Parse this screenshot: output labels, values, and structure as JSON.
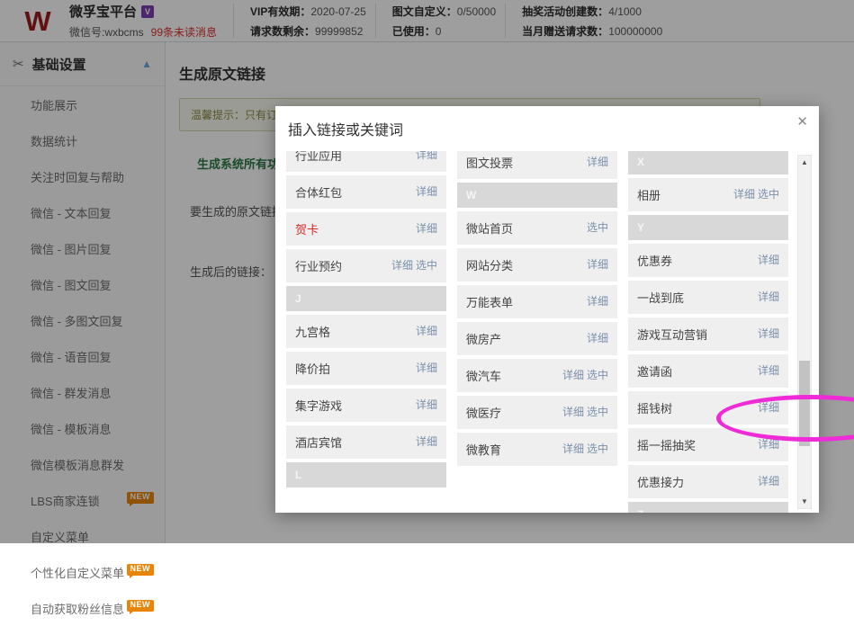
{
  "header": {
    "logo_text": "W",
    "account_name": "微孚宝平台",
    "vip_badge": "V",
    "wechat_id": "微信号:wxbcms",
    "unread": "99条未读消息",
    "stats": [
      {
        "line1_label": "VIP有效期：",
        "line1_value": "2020-07-25",
        "line2_label": "请求数剩余：",
        "line2_value": "99999852"
      },
      {
        "line1_label": "图文自定义：",
        "line1_value": "0/50000",
        "line2_label": "已使用：",
        "line2_value": "0"
      },
      {
        "line1_label": "抽奖活动创建数：",
        "line1_value": "4/1000",
        "line2_label": "当月赠送请求数：",
        "line2_value": "100000000"
      }
    ]
  },
  "sidebar": {
    "section_title": "基础设置",
    "section_icon": "tools-icon",
    "collapse_icon": "chevron-up-icon",
    "items": [
      {
        "label": "功能展示",
        "badge": ""
      },
      {
        "label": "数据统计",
        "badge": ""
      },
      {
        "label": "关注时回复与帮助",
        "badge": ""
      },
      {
        "label": "微信 - 文本回复",
        "badge": ""
      },
      {
        "label": "微信 - 图片回复",
        "badge": ""
      },
      {
        "label": "微信 - 图文回复",
        "badge": ""
      },
      {
        "label": "微信 - 多图文回复",
        "badge": ""
      },
      {
        "label": "微信 - 语音回复",
        "badge": ""
      },
      {
        "label": "微信 - 群发消息",
        "badge": ""
      },
      {
        "label": "微信 - 模板消息",
        "badge": ""
      },
      {
        "label": "微信模板消息群发",
        "badge": ""
      },
      {
        "label": "LBS商家连锁",
        "badge": "NEW"
      },
      {
        "label": "自定义菜单",
        "badge": ""
      },
      {
        "label": "个性化自定义菜单",
        "badge": "NEW"
      },
      {
        "label": "自动获取粉丝信息",
        "badge": "NEW"
      }
    ]
  },
  "page": {
    "title": "生成原文链接",
    "alert": "温馨提示：只有订阅号和服务号才可以使用该功能",
    "green_link": "生成系统所有功能的原文链接",
    "field1_label": "要生成的原文链接：",
    "field2_label": "生成后的链接："
  },
  "modal": {
    "title": "插入链接或关键词",
    "close_icon": "close-icon",
    "action_detail": "详细",
    "action_select": "选中",
    "scrollbar": {
      "up_icon": "caret-up-icon",
      "down_icon": "caret-down-icon"
    },
    "columns": [
      {
        "name": "column-1",
        "offset": -14,
        "entries": [
          {
            "type": "item",
            "label": "行业应用",
            "actions": [
              "详细"
            ],
            "red": false
          },
          {
            "type": "item",
            "label": "合体红包",
            "actions": [
              "详细"
            ],
            "red": false
          },
          {
            "type": "item",
            "label": "贺卡",
            "actions": [
              "详细"
            ],
            "red": true
          },
          {
            "type": "item",
            "label": "行业预约",
            "actions": [
              "详细",
              "选中"
            ],
            "red": false
          },
          {
            "type": "letter",
            "label": "J"
          },
          {
            "type": "item",
            "label": "九宫格",
            "actions": [
              "详细"
            ],
            "red": false
          },
          {
            "type": "item",
            "label": "降价拍",
            "actions": [
              "详细"
            ],
            "red": false
          },
          {
            "type": "item",
            "label": "集字游戏",
            "actions": [
              "详细"
            ],
            "red": false
          },
          {
            "type": "item",
            "label": "酒店宾馆",
            "actions": [
              "详细"
            ],
            "red": false
          },
          {
            "type": "letter",
            "label": "L"
          }
        ]
      },
      {
        "name": "column-2",
        "offset": -6,
        "entries": [
          {
            "type": "item",
            "label": "图文投票",
            "actions": [
              "详细"
            ],
            "red": false
          },
          {
            "type": "letter",
            "label": "W"
          },
          {
            "type": "item",
            "label": "微站首页",
            "actions": [
              "选中"
            ],
            "red": false
          },
          {
            "type": "item",
            "label": "网站分类",
            "actions": [
              "详细"
            ],
            "red": false
          },
          {
            "type": "item",
            "label": "万能表单",
            "actions": [
              "详细"
            ],
            "red": false
          },
          {
            "type": "item",
            "label": "微房产",
            "actions": [
              "详细"
            ],
            "red": false
          },
          {
            "type": "item",
            "label": "微汽车",
            "actions": [
              "详细",
              "选中"
            ],
            "red": false
          },
          {
            "type": "item",
            "label": "微医疗",
            "actions": [
              "详细",
              "选中"
            ],
            "red": false
          },
          {
            "type": "item",
            "label": "微教育",
            "actions": [
              "详细",
              "选中"
            ],
            "red": false
          }
        ]
      },
      {
        "name": "column-3",
        "offset": -2,
        "entries": [
          {
            "type": "letter",
            "label": "X"
          },
          {
            "type": "item",
            "label": "相册",
            "actions": [
              "详细",
              "选中"
            ],
            "red": false
          },
          {
            "type": "letter",
            "label": "Y"
          },
          {
            "type": "item",
            "label": "优惠券",
            "actions": [
              "详细"
            ],
            "red": false
          },
          {
            "type": "item",
            "label": "一战到底",
            "actions": [
              "详细"
            ],
            "red": false
          },
          {
            "type": "item",
            "label": "游戏互动营销",
            "actions": [
              "详细"
            ],
            "red": false
          },
          {
            "type": "item",
            "label": "邀请函",
            "actions": [
              "详细"
            ],
            "red": false
          },
          {
            "type": "item",
            "label": "摇钱树",
            "actions": [
              "详细"
            ],
            "red": false
          },
          {
            "type": "item",
            "label": "摇一摇抽奖",
            "actions": [
              "详细"
            ],
            "red": false
          },
          {
            "type": "item",
            "label": "优惠接力",
            "actions": [
              "详细"
            ],
            "red": false
          },
          {
            "type": "letter",
            "label": "Z"
          }
        ]
      }
    ]
  },
  "annotation": {
    "shape": "ellipse",
    "color": "#ef2bd7",
    "targets": "万能表单"
  },
  "colors": {
    "brand_red": "#9c1a1a",
    "unread_red": "#e03030",
    "badge_orange": "#e8860a",
    "green_link": "#2c7a46",
    "annotation": "#ef2bd7"
  }
}
